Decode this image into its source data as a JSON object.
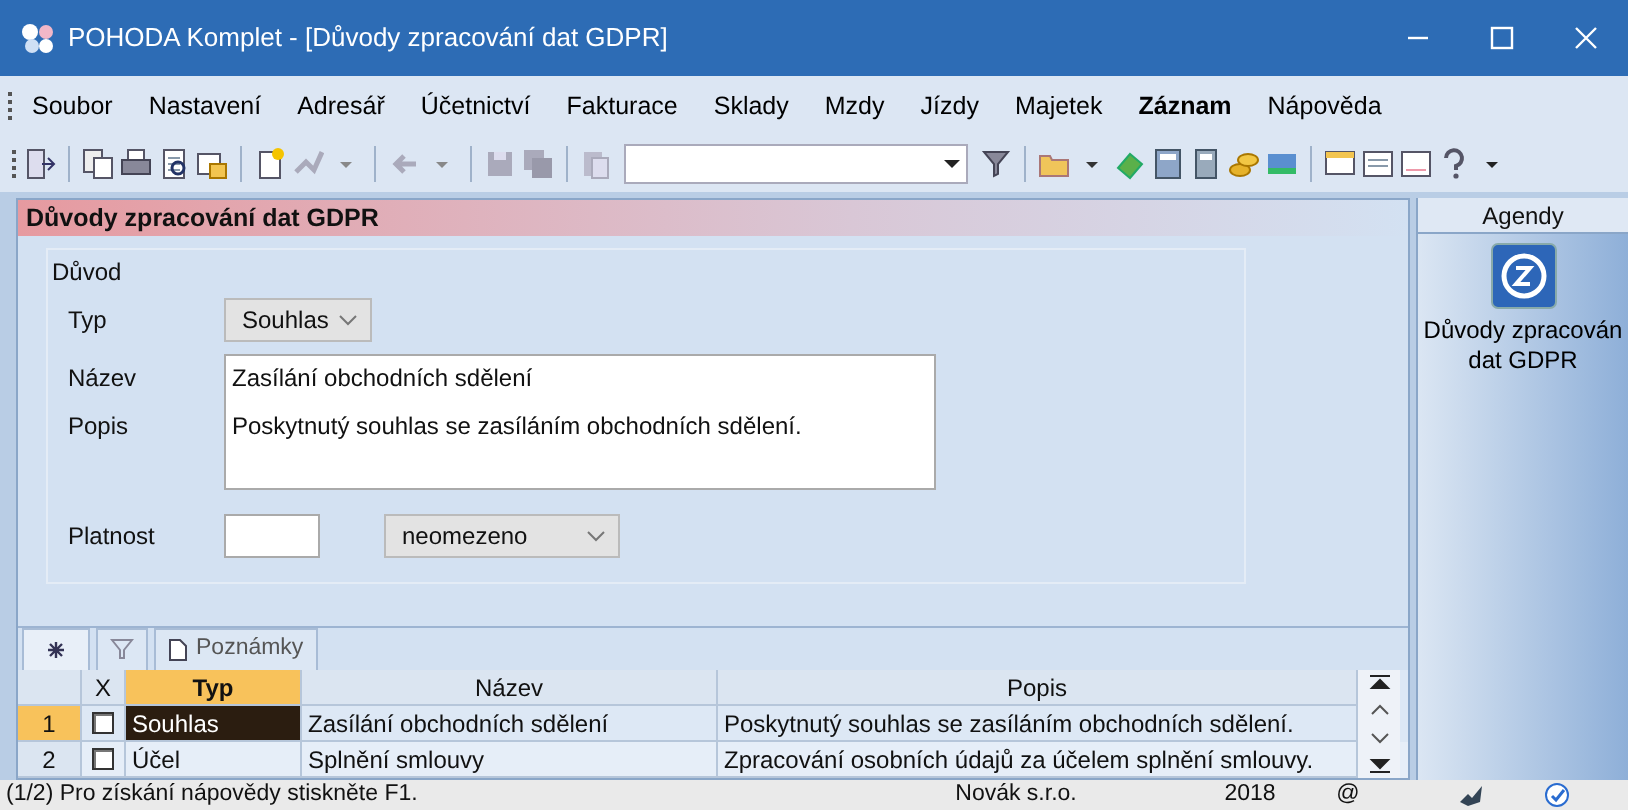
{
  "window": {
    "title": "POHODA Komplet - [Důvody zpracování dat GDPR]"
  },
  "menu": [
    {
      "label": "Soubor",
      "bold": false
    },
    {
      "label": "Nastavení",
      "bold": false
    },
    {
      "label": "Adresář",
      "bold": false
    },
    {
      "label": "Účetnictví",
      "bold": false
    },
    {
      "label": "Fakturace",
      "bold": false
    },
    {
      "label": "Sklady",
      "bold": false
    },
    {
      "label": "Mzdy",
      "bold": false
    },
    {
      "label": "Jízdy",
      "bold": false
    },
    {
      "label": "Majetek",
      "bold": false
    },
    {
      "label": "Záznam",
      "bold": true
    },
    {
      "label": "Nápověda",
      "bold": false
    }
  ],
  "section": {
    "title": "Důvody zpracování dat GDPR"
  },
  "form": {
    "group": "Důvod",
    "type": {
      "label": "Typ",
      "value": "Souhlas"
    },
    "name": {
      "label": "Název",
      "value": "Zasílání obchodních sdělení"
    },
    "description": {
      "label": "Popis",
      "value": "Poskytnutý souhlas se zasíláním obchodních sdělení."
    },
    "validity": {
      "label": "Platnost",
      "value": "neomezeno"
    }
  },
  "tabs": [
    {
      "kind": "new",
      "selected": true
    },
    {
      "kind": "filter",
      "selected": false
    },
    {
      "kind": "notes",
      "label": "Poznámky",
      "selected": false
    }
  ],
  "table": {
    "columns": [
      "X",
      "Typ",
      "Název",
      "Popis"
    ],
    "rows": [
      {
        "number": "1",
        "checked": false,
        "selected": true,
        "cells": [
          "Souhlas",
          "Zasílání obchodních sdělení",
          "Poskytnutý souhlas se zasíláním obchodních sdělení."
        ]
      },
      {
        "number": "2",
        "checked": false,
        "selected": false,
        "cells": [
          "Účel",
          "Splnění smlouvy",
          "Zpracování osobních údajů za účelem splnění smlouvy."
        ]
      }
    ]
  },
  "agendas": {
    "title": "Agendy",
    "items": [
      {
        "label": "Důvody zpracován dat GDPR"
      }
    ]
  },
  "status_bar": {
    "hint": "(1/2) Pro získání nápovědy stiskněte F1.",
    "company": "Novák s.r.o.",
    "year": "2018",
    "mail": "@"
  }
}
